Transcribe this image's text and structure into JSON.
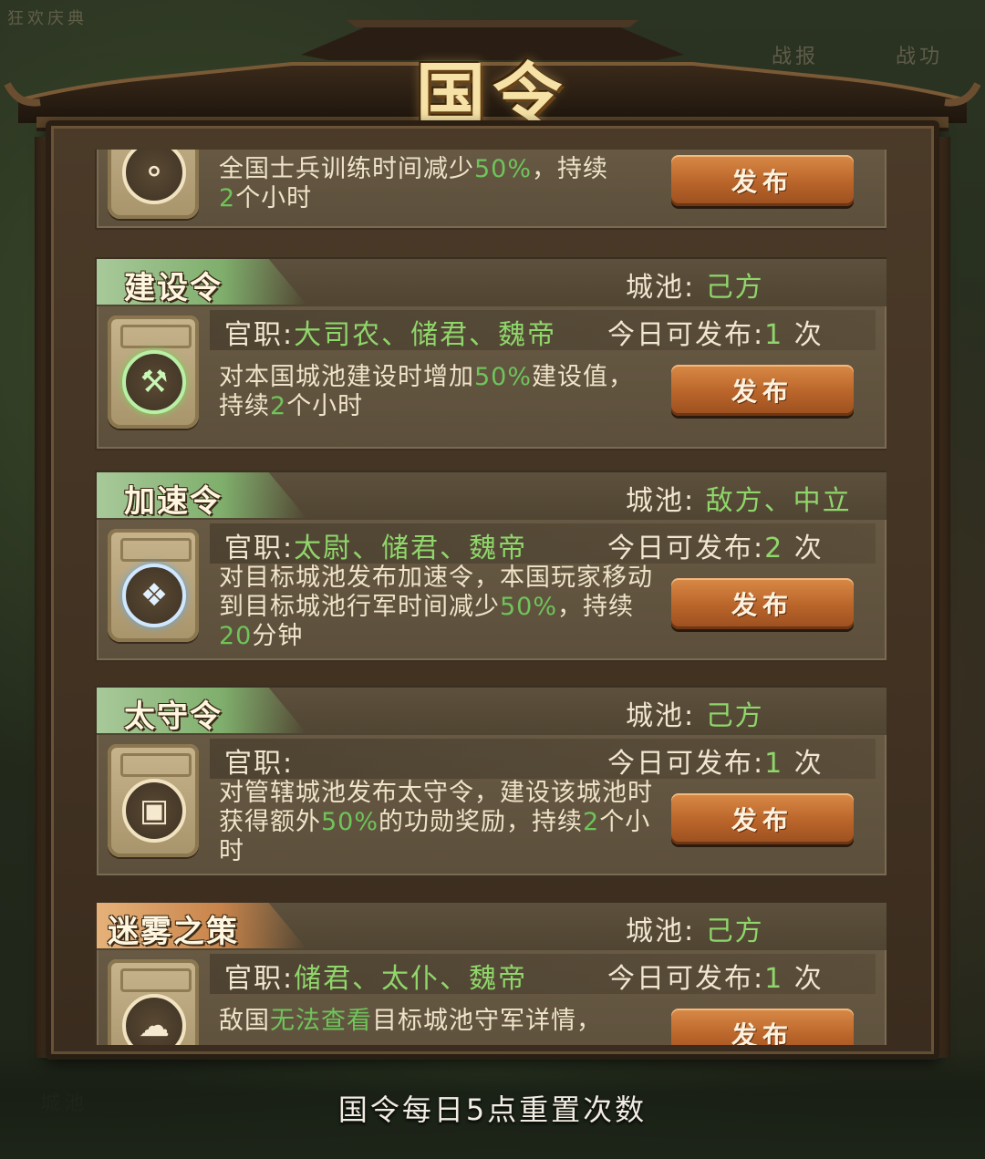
{
  "background": {
    "top_left": "狂欢庆典",
    "top_right_1": "战报",
    "top_right_2": "战功",
    "bottom_left": "城池"
  },
  "title": "国令",
  "orders": [
    {
      "name": "",
      "city_label": "",
      "city_value": "",
      "office_label": "",
      "office_value": "",
      "times_label": "",
      "times_value": "",
      "times_unit": "",
      "desc_parts": [
        "全国士兵训练时间减少",
        "50%",
        "，持续",
        "2",
        "个小时"
      ],
      "button": "发布",
      "icon": "horn-icon"
    },
    {
      "name": "建设令",
      "city_label": "城池:",
      "city_value": "己方",
      "office_label": "官职:",
      "office_value": "大司农、储君、魏帝",
      "times_label": "今日可发布:",
      "times_value": "1",
      "times_unit": "次",
      "desc_parts": [
        "对本国城池建设时增加",
        "50%",
        "建设值，持续",
        "2",
        "个小时"
      ],
      "button": "发布",
      "icon": "hammer-icon"
    },
    {
      "name": "加速令",
      "city_label": "城池:",
      "city_value": "敌方、中立",
      "office_label": "官职:",
      "office_value": "太尉、储君、魏帝",
      "times_label": "今日可发布:",
      "times_value": "2",
      "times_unit": "次",
      "desc_parts": [
        "对目标城池发布加速令，本国玩家移动到目标城池行军时间减少",
        "50%",
        "，持续",
        "20",
        "分钟"
      ],
      "button": "发布",
      "icon": "boot-icon"
    },
    {
      "name": "太守令",
      "city_label": "城池:",
      "city_value": "己方",
      "office_label": "官职:",
      "office_value": "",
      "times_label": "今日可发布:",
      "times_value": "1",
      "times_unit": "次",
      "desc_parts": [
        "对管辖城池发布太守令，建设该城池时获得额外",
        "50%",
        "的功勋奖励，持续",
        "2",
        "个小时"
      ],
      "button": "发布",
      "icon": "coin-icon"
    },
    {
      "name": "迷雾之策",
      "city_label": "城池:",
      "city_value": "己方",
      "office_label": "官职:",
      "office_value": "储君、太仆、魏帝",
      "times_label": "今日可发布:",
      "times_value": "1",
      "times_unit": "次",
      "desc_parts": [
        "敌国",
        "无法查看",
        "目标城池守军详情，"
      ],
      "button": "发布",
      "icon": "cloud-icon"
    }
  ],
  "footer": "国令每日5点重置次数",
  "colors": {
    "accent_green": "#8fd66b",
    "button_orange": "#b9642a",
    "banner_green": "#a8c99a",
    "banner_orange": "#e6b27a"
  }
}
